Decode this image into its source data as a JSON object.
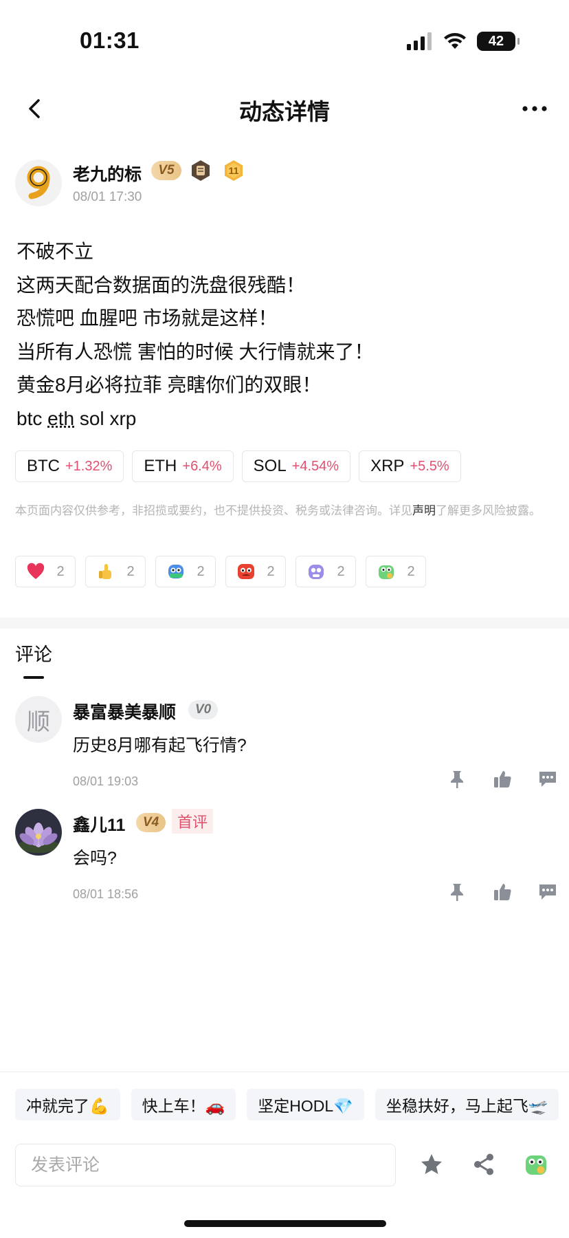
{
  "status_bar": {
    "time": "01:31",
    "battery": "42"
  },
  "nav": {
    "title": "动态详情",
    "back_icon": "chevron-left-icon",
    "more_icon": "more-icon"
  },
  "author": {
    "name": "老九的标",
    "level": "V5",
    "badge_number": "11",
    "time": "08/01 17:30"
  },
  "post": {
    "lines": [
      "不破不立",
      "这两天配合数据面的洗盘很残酷！",
      "恐慌吧 血腥吧 市场就是这样！",
      "当所有人恐慌 害怕的时候 大行情就来了！",
      "黄金8月必将拉菲 亮瞎你们的双眼！"
    ],
    "tags": [
      "btc",
      "eth",
      "sol",
      "xrp"
    ]
  },
  "coins": [
    {
      "name": "BTC",
      "change": "+1.32%"
    },
    {
      "name": "ETH",
      "change": "+6.4%"
    },
    {
      "name": "SOL",
      "change": "+4.54%"
    },
    {
      "name": "XRP",
      "change": "+5.5%"
    }
  ],
  "disclaimer": {
    "before": "本页面内容仅供参考，非招揽或要约，也不提供投资、税务或法律咨询。详见",
    "link": "声明",
    "after": "了解更多风险披露。"
  },
  "reactions": [
    {
      "icon": "heart-icon",
      "count": "2"
    },
    {
      "icon": "thumbs-up-emoji-icon",
      "count": "2"
    },
    {
      "icon": "hodl-emoji-icon",
      "count": "2"
    },
    {
      "icon": "angry-emoji-icon",
      "count": "2"
    },
    {
      "icon": "cute-emoji-icon",
      "count": "2"
    },
    {
      "icon": "frog-emoji-icon",
      "count": "2"
    }
  ],
  "comments_tab": "评论",
  "comments": [
    {
      "avatar_text": "顺",
      "name": "暴富暴美暴顺",
      "level": "V0",
      "first": "",
      "text": "历史8月哪有起飞行情?",
      "time": "08/01 19:03"
    },
    {
      "avatar_text": "",
      "name": "鑫儿11",
      "level": "V4",
      "first": "首评",
      "text": "会吗?",
      "time": "08/01 18:56"
    }
  ],
  "quick_replies": [
    "冲就完了💪",
    "快上车！🚗",
    "坚定HODL💎",
    "坐稳扶好，马上起飞🛫"
  ],
  "comment_input": {
    "placeholder": "发表评论"
  },
  "colors": {
    "up": "#e0506e",
    "muted": "#a0a0a0",
    "gold": "#e9c488"
  }
}
